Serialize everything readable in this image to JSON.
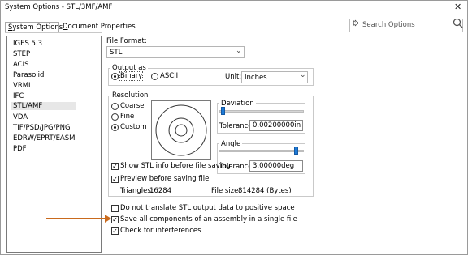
{
  "window": {
    "title": "System Options - STL/3MF/AMF",
    "close_glyph": "✕"
  },
  "tabs": [
    {
      "label": "System Options",
      "active": true
    },
    {
      "label": "Document Properties",
      "active": false
    }
  ],
  "search": {
    "placeholder": "Search Options",
    "icon": "gear-icon"
  },
  "left_list": {
    "items": [
      "IGES 5.3",
      "STEP",
      "ACIS",
      "Parasolid",
      "VRML",
      "IFC",
      "STL/AMF",
      "VDA",
      "TIF/PSD/JPG/PNG",
      "EDRW/EPRT/EASM",
      "PDF"
    ],
    "selected": "STL/AMF"
  },
  "file_format": {
    "label": "File Format:",
    "value": "STL"
  },
  "output_as": {
    "title": "Output as",
    "binary": "Binary",
    "ascii": "ASCII",
    "selected": "Binary",
    "unit_label": "Unit:",
    "unit_value": "Inches"
  },
  "resolution": {
    "title": "Resolution",
    "coarse": "Coarse",
    "fine": "Fine",
    "custom": "Custom",
    "selected": "Custom"
  },
  "deviation": {
    "title": "Deviation",
    "tolerance_label": "Tolerance:",
    "tolerance_value": "0.00200000in",
    "slider_level": 0.02
  },
  "angle": {
    "title": "Angle",
    "tolerance_label": "Tolerance:",
    "tolerance_value": "3.00000deg",
    "slider_level": 0.93
  },
  "options": {
    "show_stl_info": "Show STL info before file saving",
    "preview": "Preview before saving file",
    "triangles_label": "Triangles:",
    "triangles_value": "16284",
    "filesize_label": "File size:",
    "filesize_value": "814284 (Bytes)"
  },
  "bottom_options": {
    "translate": "Do not translate STL output data to positive space",
    "save_all": "Save all components of an assembly in a single file",
    "interferences": "Check for interferences"
  },
  "colors": {
    "annotation_arrow": "#c96a1d",
    "slider_thumb": "#1e7ad6"
  }
}
